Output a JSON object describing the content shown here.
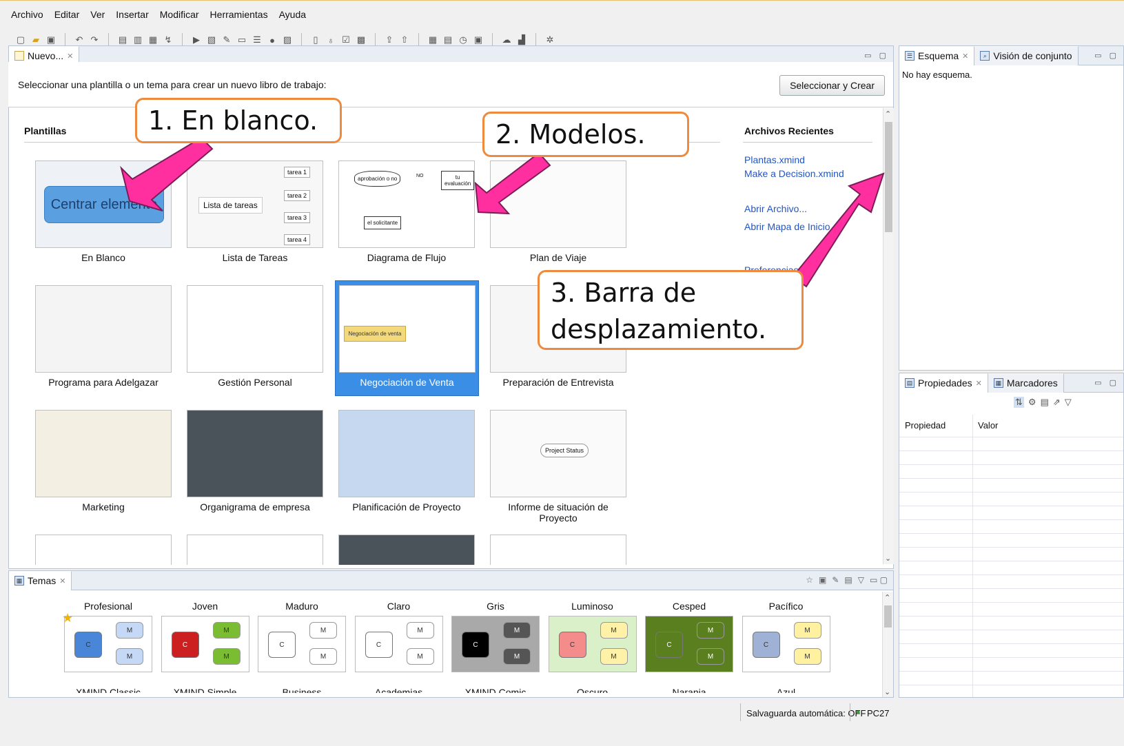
{
  "menu": [
    "Archivo",
    "Editar",
    "Ver",
    "Insertar",
    "Modificar",
    "Herramientas",
    "Ayuda"
  ],
  "toolbar_icons": [
    "new-icon",
    "open-icon",
    "save-icon",
    "undo-icon",
    "redo-icon",
    "topic-icon",
    "subtopic-icon",
    "float-icon",
    "relationship-icon",
    "presentation-icon",
    "export-icon",
    "brush-icon",
    "boundary-icon",
    "summary-icon",
    "marker-icon",
    "image-icon",
    "note-icon",
    "comment-icon",
    "bulb-icon",
    "task-icon",
    "gantt-icon",
    "share-icon",
    "upload-icon",
    "grid-icon",
    "calendar-icon",
    "clock-icon",
    "view-icon",
    "cloud-icon",
    "chart-icon",
    "settings-icon"
  ],
  "editor": {
    "tab_label": "Nuevo...",
    "header_text": "Seleccionar una plantilla o un tema para crear un nuevo libro de trabajo:",
    "select_button": "Seleccionar y Crear",
    "templates_title": "Plantillas",
    "templates": [
      {
        "name": "En Blanco",
        "preview": "Centrar elemento"
      },
      {
        "name": "Lista de Tareas",
        "preview": "Lista de tareas",
        "tasks": [
          "tarea 1",
          "tarea 2",
          "tarea 3",
          "tarea 4"
        ]
      },
      {
        "name": "Diagrama de Flujo",
        "preview": [
          "aprobación o no",
          "NO",
          "tu evaluación",
          "el solicitante"
        ]
      },
      {
        "name": "Plan de Viaje"
      },
      {
        "name": "Programa para Adelgazar"
      },
      {
        "name": "Gestión Personal"
      },
      {
        "name": "Negociación de Venta",
        "preview": "Negociación de venta",
        "selected": true
      },
      {
        "name": "Preparación de Entrevista"
      },
      {
        "name": "Marketing"
      },
      {
        "name": "Organigrama de empresa"
      },
      {
        "name": "Planificación de Proyecto"
      },
      {
        "name": "Informe de situación de Proyecto",
        "preview": "Project Status"
      },
      {
        "name": ""
      },
      {
        "name": ""
      },
      {
        "name": ""
      },
      {
        "name": ""
      }
    ],
    "recent_title": "Archivos Recientes",
    "recent_files": [
      "Plantas.xmind",
      "Make a Decision.xmind"
    ],
    "recent_links": [
      "Abrir Archivo...",
      "Abrir Mapa de Inicio"
    ],
    "recent_partial": "Preferencias"
  },
  "outline": {
    "tab1": "Esquema",
    "tab2": "Visión de conjunto",
    "empty_text": "No hay esquema."
  },
  "properties": {
    "tab1": "Propiedades",
    "tab2": "Marcadores",
    "col1": "Propiedad",
    "col2": "Valor"
  },
  "themes": {
    "tab_label": "Temas",
    "items": [
      {
        "title": "Profesional",
        "subtitle": "XMIND Classic",
        "bg": "#ffffff",
        "center": "#4a86d8",
        "center_text": "C",
        "branch": "#c5d8f5",
        "branch_text": "M",
        "star": true
      },
      {
        "title": "Joven",
        "subtitle": "XMIND Simple",
        "bg": "#ffffff",
        "center": "#cc1f1f",
        "center_text": "C",
        "branch": "#7bbd32",
        "branch_text": "M"
      },
      {
        "title": "Maduro",
        "subtitle": "Business",
        "bg": "#ffffff",
        "center": "#ffffff",
        "center_text": "C",
        "branch": "#ffffff",
        "branch_text": "M"
      },
      {
        "title": "Claro",
        "subtitle": "Academias",
        "bg": "#ffffff",
        "center": "#ffffff",
        "center_text": "C",
        "branch": "#ffffff",
        "branch_text": "M"
      },
      {
        "title": "Gris",
        "subtitle": "XMIND Comic",
        "bg": "#a9a9a9",
        "center": "#000000",
        "center_text": "C",
        "branch": "#555555",
        "branch_text": "M"
      },
      {
        "title": "Luminoso",
        "subtitle": "Oscuro",
        "bg": "#d9f0c8",
        "center": "#f48c8c",
        "center_text": "C",
        "branch": "#fff2a8",
        "branch_text": "M"
      },
      {
        "title": "Cesped",
        "subtitle": "Naranja",
        "bg": "#5a7f1e",
        "center": "#5a7f1e",
        "center_text": "C",
        "branch": "#5a7f1e",
        "branch_text": "M"
      },
      {
        "title": "Pacífico",
        "subtitle": "Azul",
        "bg": "#ffffff",
        "center": "#9fb2d6",
        "center_text": "C",
        "branch": "#fff1a0",
        "branch_text": "M"
      }
    ]
  },
  "status": {
    "autosave": "Salvaguarda automática: OFF",
    "user": "PC27"
  },
  "callouts": {
    "c1": "1. En blanco.",
    "c2": "2. Modelos.",
    "c3_line1": "3. Barra de",
    "c3_line2": "desplazamiento."
  },
  "colors": {
    "accent": "#3a8ee6",
    "callout_border": "#ee8a3d",
    "arrow": "#ff2fa0"
  }
}
